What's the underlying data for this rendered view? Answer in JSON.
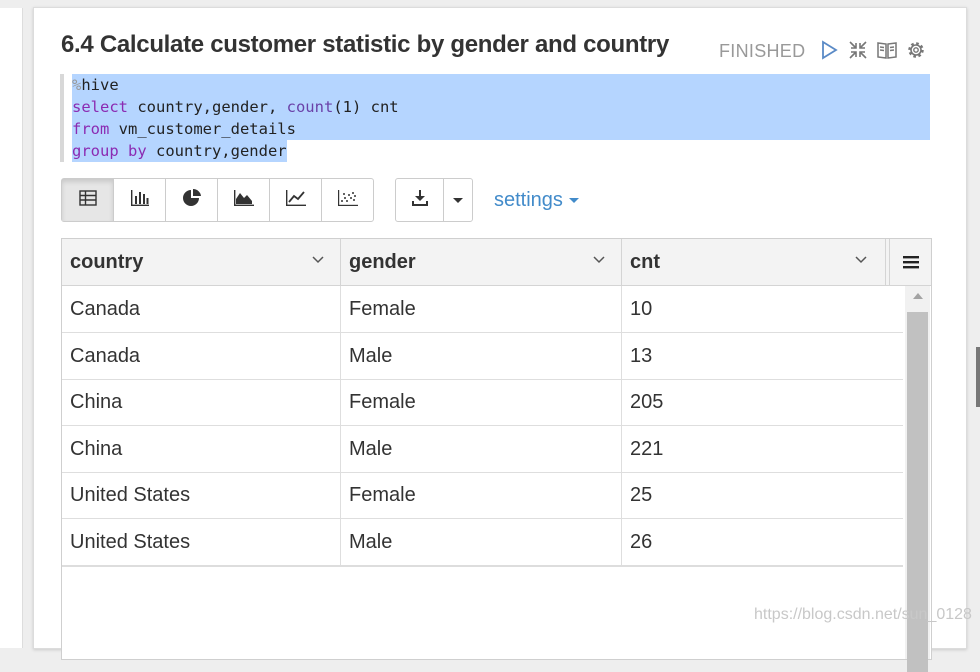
{
  "paragraph": {
    "title": "6.4 Calculate customer statistic by gender and country",
    "status": "FINISHED",
    "controls": [
      "run-icon",
      "collapse-icon",
      "book-icon",
      "gear-icon"
    ]
  },
  "editor": {
    "lines": [
      {
        "segments": [
          {
            "text": "%",
            "cls": "pct"
          },
          {
            "text": "hive",
            "cls": ""
          }
        ]
      },
      {
        "segments": [
          {
            "text": "select",
            "cls": "kw"
          },
          {
            "text": " country,gender, ",
            "cls": ""
          },
          {
            "text": "count",
            "cls": "fn"
          },
          {
            "text": "(1) cnt",
            "cls": ""
          }
        ]
      },
      {
        "segments": [
          {
            "text": "from",
            "cls": "kw"
          },
          {
            "text": " vm_customer_details",
            "cls": ""
          }
        ]
      },
      {
        "segments": [
          {
            "text": "group by",
            "cls": "kw"
          },
          {
            "text": " country,gender",
            "cls": ""
          }
        ]
      }
    ],
    "selection_color": "#b5d5ff"
  },
  "toolbar": {
    "views": [
      "table-icon",
      "bar-chart-icon",
      "pie-chart-icon",
      "area-chart-icon",
      "line-chart-icon",
      "scatter-chart-icon"
    ],
    "active_view": "table-icon",
    "settings_label": "settings"
  },
  "table": {
    "columns": [
      "country",
      "gender",
      "cnt"
    ],
    "rows": [
      [
        "Canada",
        "Female",
        "10"
      ],
      [
        "Canada",
        "Male",
        "13"
      ],
      [
        "China",
        "Female",
        "205"
      ],
      [
        "China",
        "Male",
        "221"
      ],
      [
        "United States",
        "Female",
        "25"
      ],
      [
        "United States",
        "Male",
        "26"
      ]
    ]
  },
  "watermark": "https://blog.csdn.net/sun_0128",
  "colors": {
    "link": "#428bca",
    "keyword": "#8b2bb2"
  }
}
